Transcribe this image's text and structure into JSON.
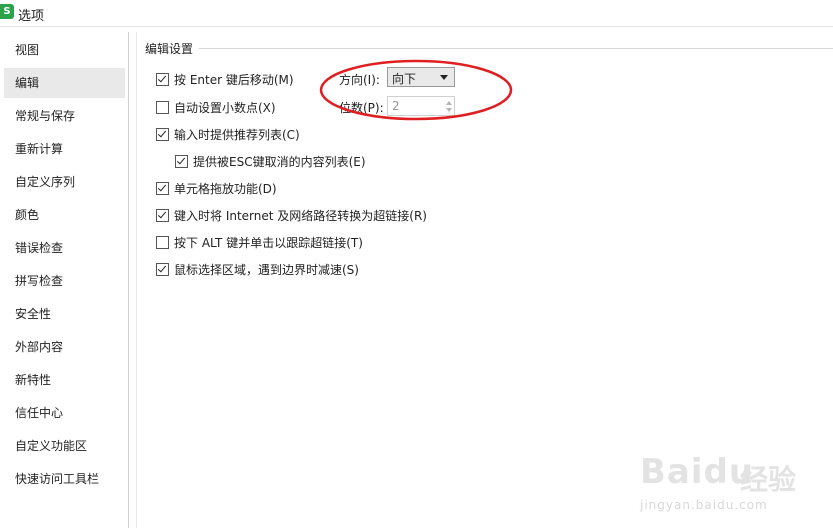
{
  "window": {
    "logo_text": "S",
    "title": "选项"
  },
  "sidebar": {
    "items": [
      {
        "label": "视图"
      },
      {
        "label": "编辑",
        "active": true
      },
      {
        "label": "常规与保存"
      },
      {
        "label": "重新计算"
      },
      {
        "label": "自定义序列"
      },
      {
        "label": "颜色"
      },
      {
        "label": "错误检查"
      },
      {
        "label": "拼写检查"
      },
      {
        "label": "安全性"
      },
      {
        "label": "外部内容"
      },
      {
        "label": "新特性"
      },
      {
        "label": "信任中心"
      },
      {
        "label": "自定义功能区"
      },
      {
        "label": "快速访问工具栏"
      }
    ]
  },
  "edit_settings": {
    "section_title": "编辑设置",
    "options": [
      {
        "label": "按 Enter 键后移动(M)",
        "checked": true
      },
      {
        "label": "自动设置小数点(X)",
        "checked": false
      },
      {
        "label": "输入时提供推荐列表(C)",
        "checked": true
      },
      {
        "label": "提供被ESC键取消的内容列表(E)",
        "checked": true
      },
      {
        "label": "单元格拖放功能(D)",
        "checked": true
      },
      {
        "label": "键入时将 Internet 及网络路径转换为超链接(R)",
        "checked": true
      },
      {
        "label": "按下 ALT 键并单击以跟踪超链接(T)",
        "checked": false
      },
      {
        "label": "鼠标选择区域，遇到边界时减速(S)",
        "checked": true
      }
    ],
    "direction_label": "方向(I):",
    "direction_value": "向下",
    "digits_label": "位数(P):",
    "digits_value": "2"
  },
  "annotation": {
    "color": "#e02020"
  },
  "watermark": {
    "brand": "Baidu",
    "brand_cn": "经验",
    "url": "jingyan.baidu.com"
  }
}
